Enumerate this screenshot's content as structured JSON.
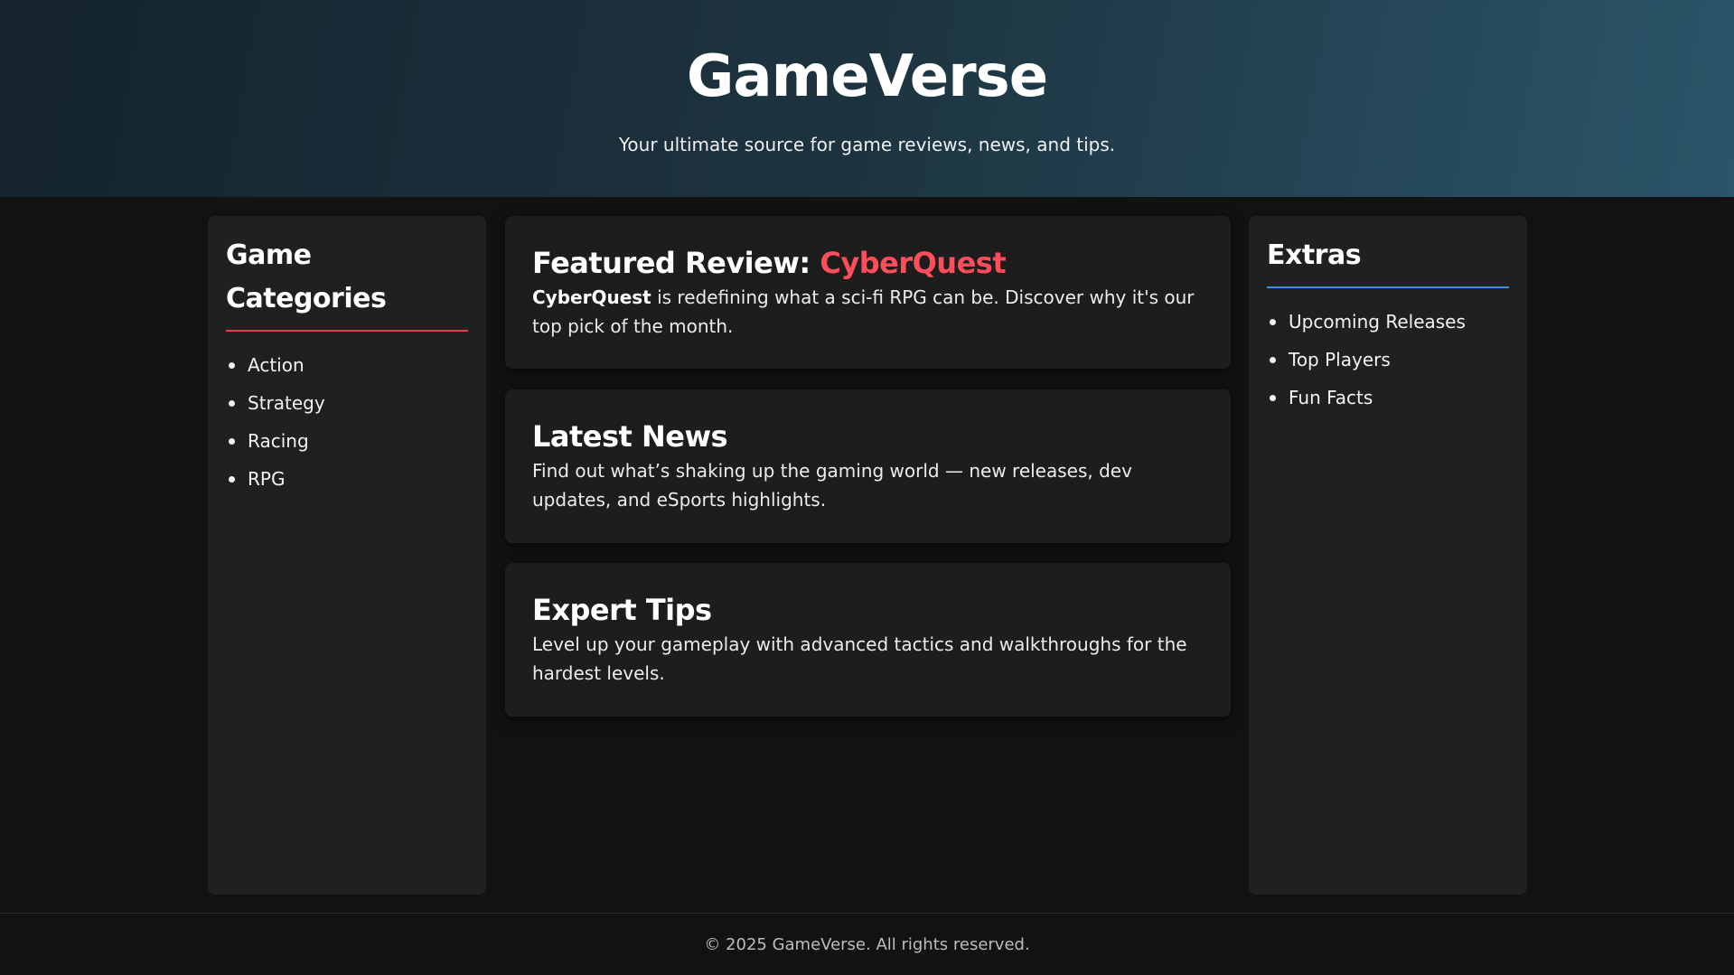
{
  "header": {
    "title": "GameVerse",
    "tagline": "Your ultimate source for game reviews, news, and tips."
  },
  "sidebar_left": {
    "heading": "Game Categories",
    "items": [
      "Action",
      "Strategy",
      "Racing",
      "RPG"
    ]
  },
  "main": {
    "featured": {
      "heading_prefix": "Featured Review: ",
      "heading_highlight": "CyberQuest",
      "body_bold": "CyberQuest",
      "body_text": " is redefining what a sci-fi RPG can be. Discover why it's our top pick of the month."
    },
    "news": {
      "heading": "Latest News",
      "body": "Find out what’s shaking up the gaming world — new releases, dev updates, and eSports highlights."
    },
    "tips": {
      "heading": "Expert Tips",
      "body": "Level up your gameplay with advanced tactics and walkthroughs for the hardest levels."
    }
  },
  "sidebar_right": {
    "heading": "Extras",
    "items": [
      "Upcoming Releases",
      "Top Players",
      "Fun Facts"
    ]
  },
  "footer": {
    "text": "© 2025 GameVerse. All rights reserved."
  },
  "colors": {
    "accent_red": "#ff4d5a",
    "accent_blue": "#3d8de0",
    "background": "#121212",
    "panel": "#202020"
  }
}
